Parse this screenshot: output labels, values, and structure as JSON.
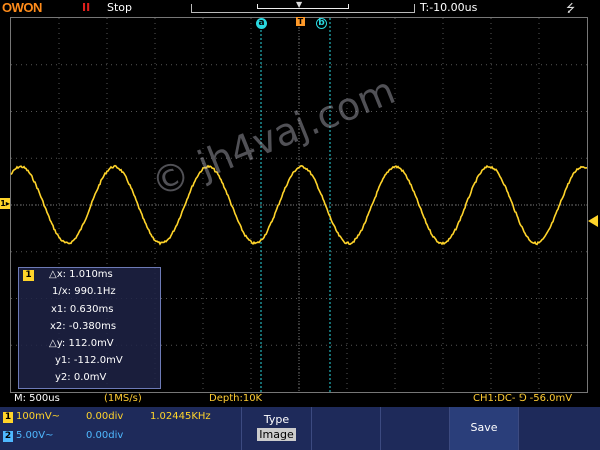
{
  "header": {
    "logo": "OWON",
    "run_icon": "II",
    "run_state": "Stop",
    "trigger_offset": "T:-10.00us",
    "usb_icon_name": "usb-icon"
  },
  "cursors": {
    "a_label": "a",
    "b_label": "b",
    "trigger_marker": "T"
  },
  "cursor_readout": {
    "channel": "1",
    "dx_label": "△x:",
    "dx": "1.010ms",
    "inv_dx_label": "1/x:",
    "inv_dx": "990.1Hz",
    "x1_label": "x1:",
    "x1": "0.630ms",
    "x2_label": "x2:",
    "x2": "-0.380ms",
    "dy_label": "△y:",
    "dy": "112.0mV",
    "y1_label": "y1:",
    "y1": "-112.0mV",
    "y2_label": "y2:",
    "y2": "0.0mV"
  },
  "watermark": "© jh4vaj.com",
  "status": {
    "timebase": "M: 500us",
    "sample_rate": "(1MS/s)",
    "depth": "Depth:10K",
    "trigger": "CH1:DC- ⅁ -56.0mV"
  },
  "channels": [
    {
      "num": "1",
      "scale": "100mV~",
      "offset": "0.00div",
      "freq": "1.02445KHz",
      "color": "#ffd42a"
    },
    {
      "num": "2",
      "scale": "5.00V~",
      "offset": "0.00div",
      "freq": "",
      "color": "#4fb8ff"
    }
  ],
  "menu": {
    "type_label": "Type",
    "type_value": "Image",
    "save_label": "Save"
  },
  "colors": {
    "ch1": "#ffd42a",
    "ch2": "#4fb8ff",
    "cursor": "#2ad8e0",
    "trigger": "#ff9a2a",
    "menu_bg": "#1e2a5a"
  },
  "waveform": {
    "channel": "CH1",
    "shape": "sine",
    "frequency_hz": 1024.45,
    "amplitude_div": 1.0,
    "timebase_per_div": "500us"
  }
}
